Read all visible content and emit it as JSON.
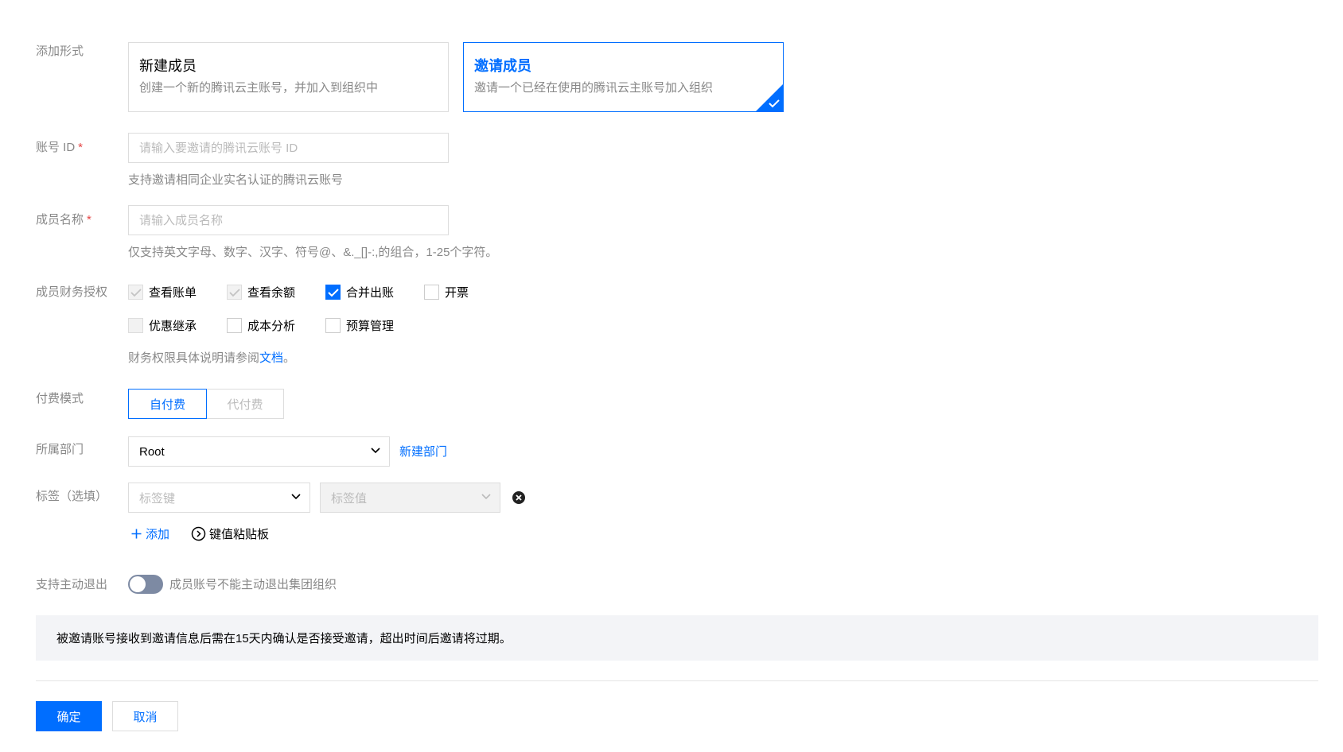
{
  "add_type": {
    "label": "添加形式",
    "options": [
      {
        "title": "新建成员",
        "desc": "创建一个新的腾讯云主账号，并加入到组织中",
        "selected": false
      },
      {
        "title": "邀请成员",
        "desc": "邀请一个已经在使用的腾讯云主账号加入组织",
        "selected": true
      }
    ]
  },
  "account_id": {
    "label": "账号 ID",
    "required_mark": "*",
    "placeholder": "请输入要邀请的腾讯云账号 ID",
    "hint": "支持邀请相同企业实名认证的腾讯云账号"
  },
  "member_name": {
    "label": "成员名称",
    "required_mark": "*",
    "placeholder": "请输入成员名称",
    "hint": "仅支持英文字母、数字、汉字、符号@、&._[]-:,的组合，1-25个字符。"
  },
  "finance_auth": {
    "label": "成员财务授权",
    "options": [
      {
        "label": "查看账单",
        "checked": true,
        "disabled": true
      },
      {
        "label": "查看余额",
        "checked": true,
        "disabled": true
      },
      {
        "label": "合并出账",
        "checked": true,
        "disabled": false
      },
      {
        "label": "开票",
        "checked": false,
        "disabled": false
      },
      {
        "label": "优惠继承",
        "checked": false,
        "disabled": true
      },
      {
        "label": "成本分析",
        "checked": false,
        "disabled": false
      },
      {
        "label": "预算管理",
        "checked": false,
        "disabled": false
      }
    ],
    "hint_prefix": "财务权限具体说明请参阅",
    "hint_link": "文档",
    "hint_suffix": "。"
  },
  "pay_mode": {
    "label": "付费模式",
    "options": [
      "自付费",
      "代付费"
    ],
    "selected": "自付费"
  },
  "department": {
    "label": "所属部门",
    "value": "Root",
    "new_link": "新建部门"
  },
  "tags": {
    "label": "标签（选填）",
    "key_placeholder": "标签键",
    "value_placeholder": "标签值",
    "add_label": "添加",
    "paste_label": "键值粘贴板"
  },
  "quit": {
    "label": "支持主动退出",
    "enabled": false,
    "desc": "成员账号不能主动退出集团组织"
  },
  "notice": "被邀请账号接收到邀请信息后需在15天内确认是否接受邀请，超出时间后邀请将过期。",
  "actions": {
    "confirm": "确定",
    "cancel": "取消"
  },
  "colors": {
    "primary": "#006eff",
    "muted_text": "#888888",
    "border": "#dddddd",
    "required": "#e54545"
  }
}
